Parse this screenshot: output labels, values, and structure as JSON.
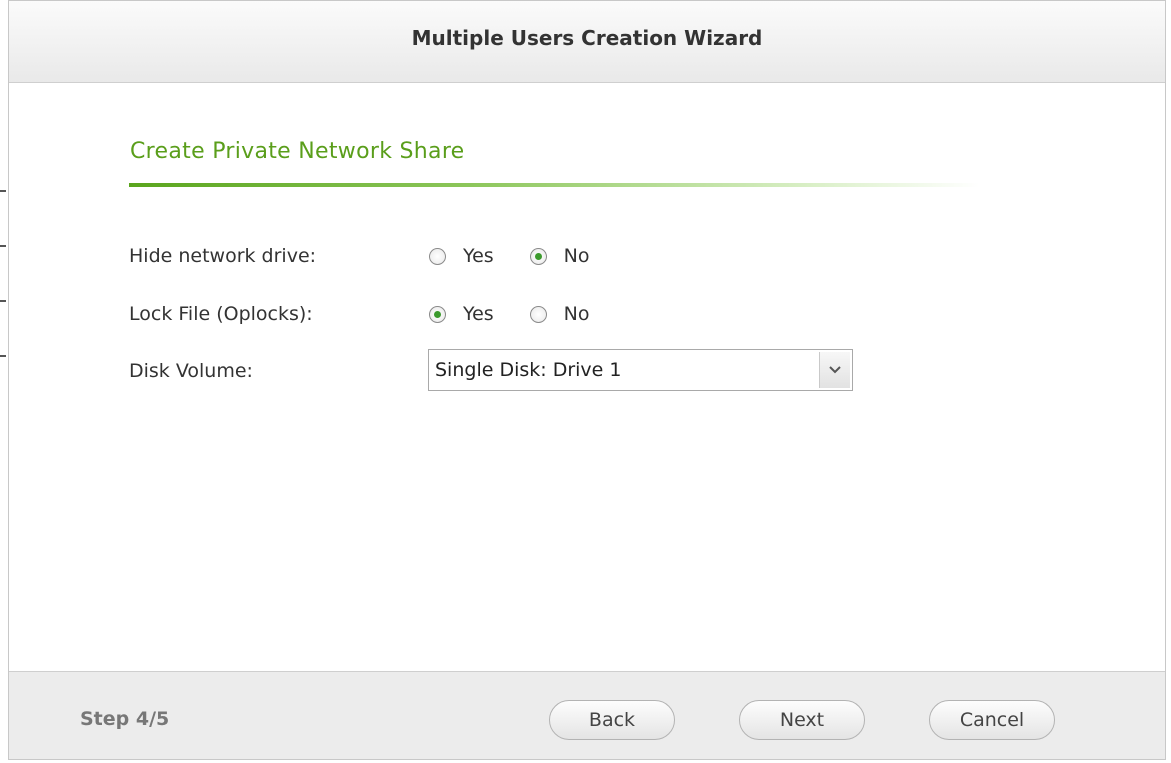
{
  "window": {
    "title": "Multiple Users Creation Wizard"
  },
  "section": {
    "title": "Create Private Network Share",
    "accent_color": "#5a9e1b"
  },
  "form": {
    "hide_network_drive": {
      "label": "Hide network drive:",
      "options": [
        "Yes",
        "No"
      ],
      "selected": "No"
    },
    "lock_file": {
      "label": "Lock File (Oplocks):",
      "options": [
        "Yes",
        "No"
      ],
      "selected": "Yes"
    },
    "disk_volume": {
      "label": "Disk Volume:",
      "value": "Single Disk: Drive  1"
    }
  },
  "footer": {
    "step": "Step 4/5",
    "back_label": "Back",
    "next_label": "Next",
    "cancel_label": "Cancel"
  },
  "icons": {
    "dropdown": "chevron-down-icon",
    "radio_selected_color": "#3b9a2c"
  }
}
